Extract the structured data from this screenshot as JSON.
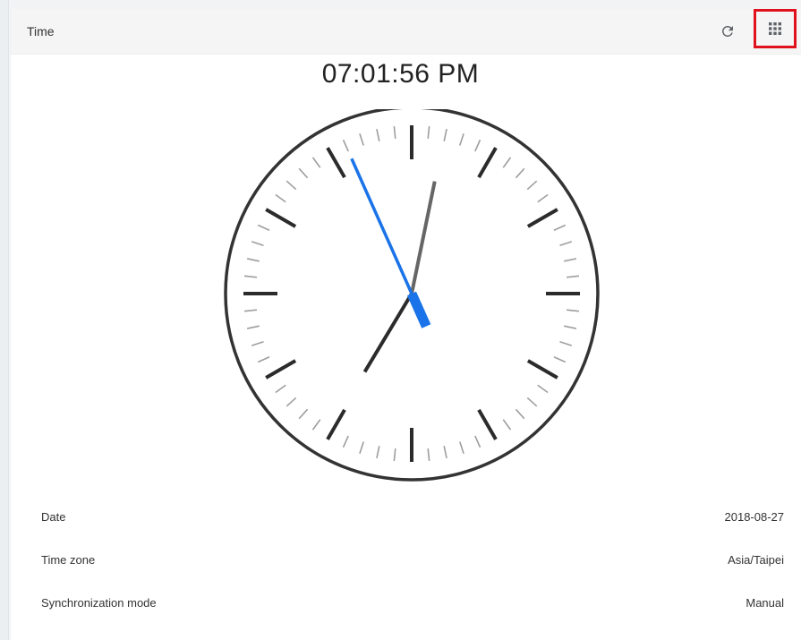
{
  "card": {
    "title": "Time"
  },
  "header_actions": {
    "refresh_icon": "refresh-icon",
    "apps_icon": "apps-grid-icon"
  },
  "clock": {
    "digital_time": "07:01:56 PM",
    "hours": 19,
    "minutes": 1,
    "seconds": 56,
    "colors": {
      "face_border": "#333333",
      "hour_hand": "#2b2b2b",
      "minute_hand": "#666666",
      "second_hand": "#1a73e8",
      "major_tick": "#2b2b2b",
      "minor_tick": "#9e9e9e"
    }
  },
  "info": {
    "rows": [
      {
        "label": "Date",
        "value": "2018-08-27"
      },
      {
        "label": "Time zone",
        "value": "Asia/Taipei"
      },
      {
        "label": "Synchronization mode",
        "value": "Manual"
      }
    ]
  },
  "accent": {
    "highlight_border": "#e0121e"
  }
}
